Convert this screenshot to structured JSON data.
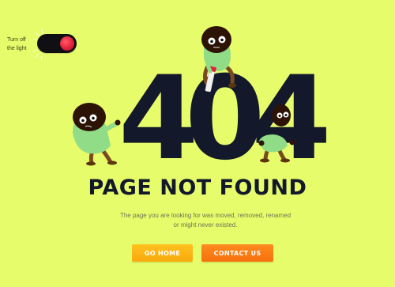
{
  "colors": {
    "background": "#e6fc6b",
    "digits": "#13182b",
    "switch_track": "#0f0f14",
    "switch_knob": "#e2223a",
    "button_home": "#f9a90d",
    "button_contact": "#f6700c"
  },
  "light_switch": {
    "label": "Turn off\nthe light",
    "state": "on"
  },
  "error_code": {
    "digit1": "4",
    "digit2": "0",
    "digit3": "4"
  },
  "headline": "PAGE NOT FOUND",
  "message": "The page you are looking for was moved, removed, renamed or might never existed.",
  "buttons": {
    "home_label": "GO HOME",
    "contact_label": "CONTACT US"
  }
}
